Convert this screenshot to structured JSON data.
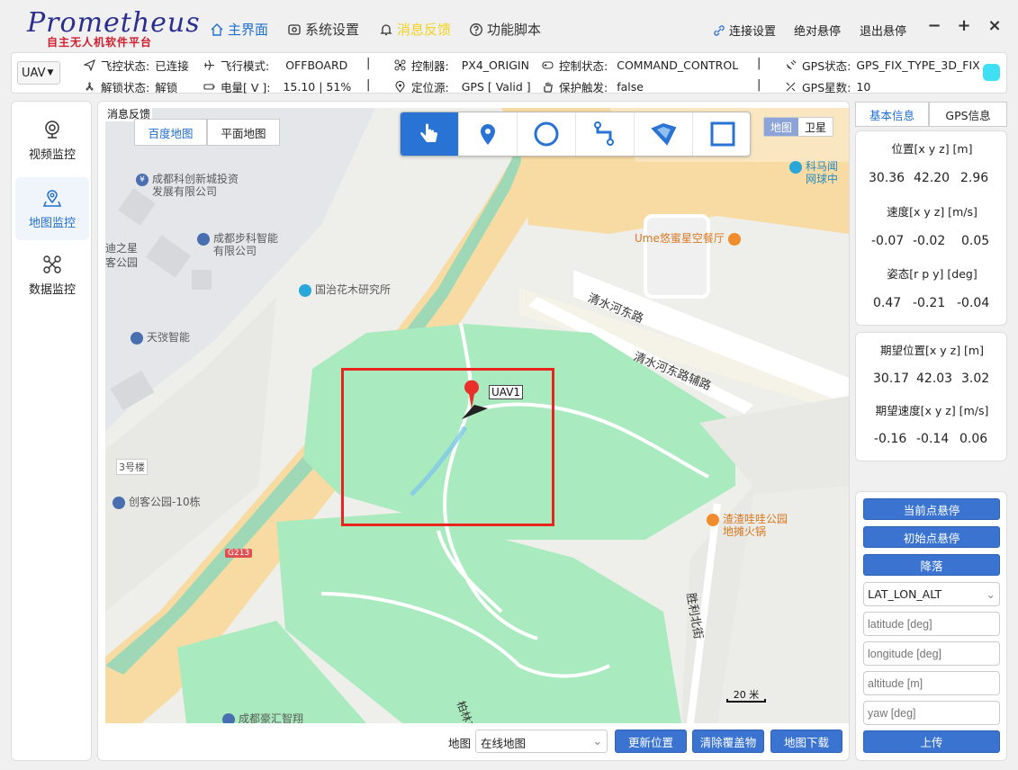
{
  "app": {
    "logo_main": "Prometheus",
    "logo_sub": "自主无人机软件平台"
  },
  "nav": {
    "home": "主界面",
    "settings": "系统设置",
    "feedback": "消息反馈",
    "scripts": "功能脚本"
  },
  "top_right": {
    "connect": "连接设置",
    "abs_hover": "绝对悬停",
    "exit_hover": "退出悬停"
  },
  "window": {
    "minimize": "−",
    "maximize": "+",
    "close": "×"
  },
  "status": {
    "uav_select": "UAV",
    "fc_label": "飞控状态:",
    "fc_value": "已连接",
    "mode_label": "飞行模式:",
    "mode_value": "OFFBOARD",
    "ctrl_label": "控制器:",
    "ctrl_value": "PX4_ORIGIN",
    "ctrlstate_label": "控制状态:",
    "ctrlstate_value": "COMMAND_CONTROL",
    "gps_label": "GPS状态:",
    "gps_value": "GPS_FIX_TYPE_3D_FIX",
    "arm_label": "解锁状态:",
    "arm_value": "解锁",
    "batt_label": "电量[ V ]:",
    "batt_value": "15.10 | 51%",
    "loc_label": "定位源:",
    "loc_value": "GPS [ Valid ]",
    "protect_label": "保护触发:",
    "protect_value": "false",
    "sats_label": "GPS星数:",
    "sats_value": "10",
    "separator": "|",
    "gps_indicator_color": "#3fe0f4"
  },
  "leftnav": {
    "video": "视频监控",
    "map": "地图监控",
    "data": "数据监控"
  },
  "map": {
    "panel_label": "消息反馈",
    "tab_baidu": "百度地图",
    "tab_flat": "平面地图",
    "toggle_map": "地图",
    "toggle_sat": "卫星",
    "uav_tag": "UAV1",
    "scale": "20 米",
    "labels": {
      "road1": "清水河东路",
      "road2": "清水河东路辅路",
      "road3": "胜利北街",
      "road4": "柏林东",
      "building": "3号楼",
      "g213": "G213",
      "park": "迪之星\n客公园"
    },
    "pois": {
      "p1": "成都科创新城投资\n发展有限公司",
      "p2": "成都步科智能\n有限公司",
      "p3": "国治花木研究所",
      "p4": "天弢智能",
      "p5": "创客公园-10栋",
      "p6": "Ume悠蜜星空餐厅",
      "p7": "科马闻\n网球中",
      "p8": "渣渣哇哇公园\n地摊火锅",
      "p9": "成都豪汇智翔"
    }
  },
  "map_controls": {
    "label": "地图",
    "select_value": "在线地图",
    "update": "更新位置",
    "clear": "清除覆盖物",
    "download": "地图下载"
  },
  "right": {
    "tab_basic": "基本信息",
    "tab_gps": "GPS信息",
    "pos_label": "位置[x y z] [m]",
    "pos": [
      "30.36",
      "42.20",
      "2.96"
    ],
    "vel_label": "速度[x y z] [m/s]",
    "vel": [
      "-0.07",
      "-0.02",
      "0.05"
    ],
    "att_label": "姿态[r p y] [deg]",
    "att": [
      "0.47",
      "-0.21",
      "-0.04"
    ],
    "dpos_label": "期望位置[x y z] [m]",
    "dpos": [
      "30.17",
      "42.03",
      "3.02"
    ],
    "dvel_label": "期望速度[x y z] [m/s]",
    "dvel": [
      "-0.16",
      "-0.14",
      "0.06"
    ],
    "btn_hover_current": "当前点悬停",
    "btn_hover_init": "初始点悬停",
    "btn_land": "降落",
    "frame_select": "LAT_LON_ALT",
    "ph_lat": "latitude [deg]",
    "ph_lon": "longitude [deg]",
    "ph_alt": "altitude [m]",
    "ph_yaw": "yaw [deg]",
    "btn_upload": "上传"
  }
}
